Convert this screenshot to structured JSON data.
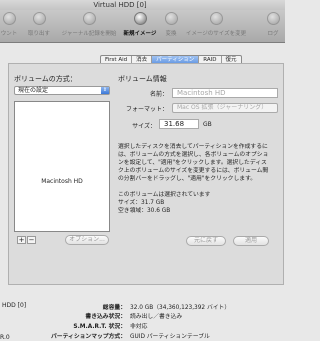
{
  "window": {
    "title": "Virtual  HDD [0]"
  },
  "toolbar": {
    "items": [
      {
        "label": "ウント"
      },
      {
        "label": "取り出す"
      },
      {
        "label": "ジャーナル記録を開始"
      },
      {
        "label": "新規イメージ"
      },
      {
        "label": "変換"
      },
      {
        "label": "イメージのサイズを変更"
      },
      {
        "label": "ログ"
      }
    ]
  },
  "tabs": [
    "First Aid",
    "消去",
    "パーティション",
    "RAID",
    "復元"
  ],
  "left": {
    "scheme_label": "ボリュームの方式：",
    "scheme_value": "現在の設定",
    "layout_partition_name": "Macintosh HD",
    "add_label": "+",
    "remove_label": "−",
    "options_label": "オプション..."
  },
  "right": {
    "heading": "ボリューム情報",
    "name_label": "名前：",
    "name_value": "Macintosh HD",
    "format_label": "フォーマット：",
    "format_value": "Mac OS 拡張（ジャーナリング）",
    "size_label": "サイズ：",
    "size_value": "31.68",
    "size_unit": "GB",
    "desc_lines": [
      "選択したディスクを消去してパーティションを作成するに",
      "は、ボリュームの方式を選択し、各ボリュームのオプショ",
      "ンを設定して、\"適用\"をクリックします。選択したディス",
      "ク上のボリュームのサイズを変更するには、ボリューム間",
      "の分割バーをドラッグし、\"適用\"をクリックします。"
    ],
    "vol_title": "このボリュームは選択されています",
    "vol_size": "サイズ：31.7 GB",
    "vol_free": "空き領域：30.6 GB",
    "revert_label": "元に戻す",
    "apply_label": "適用"
  },
  "summary": {
    "left_name": "HDD [0]",
    "left_version": "R.0",
    "rows": [
      {
        "key": "総容量：",
        "value": "32.0 GB（34,360,123,392 バイト）"
      },
      {
        "key": "書き込み状況：",
        "value": "読み出し／書き込み"
      },
      {
        "key": "S.M.A.R.T. 状況：",
        "value": "非対応"
      },
      {
        "key": "パーティションマップ方式：",
        "value": "GUID パーティションテーブル"
      }
    ]
  }
}
